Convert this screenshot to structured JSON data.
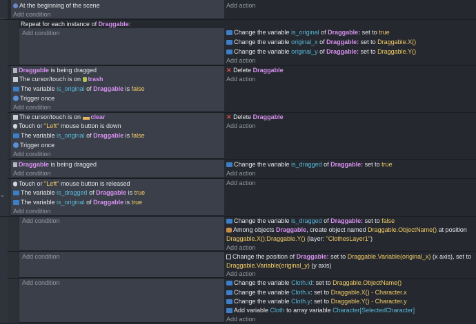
{
  "ui": {
    "add_condition": "Add condition",
    "add_action": "Add action"
  },
  "ev1": {
    "cond": "At the beginning of the scene"
  },
  "ev2": {
    "header_pre": "Repeat for each instance of ",
    "obj": "Draggable",
    "colon": ":",
    "a1": {
      "pre": "Change the variable ",
      "var": "is_original",
      "of": " of ",
      "obj": "Draggable:",
      "mid": " set to ",
      "val": "true"
    },
    "a2": {
      "pre": "Change the variable ",
      "var": "original_x",
      "of": " of ",
      "obj": "Draggable:",
      "mid": " set to ",
      "val": "Draggable.X()"
    },
    "a3": {
      "pre": "Change the variable ",
      "var": "original_y",
      "of": " of ",
      "obj": "Draggable:",
      "mid": " set to ",
      "val": "Draggable.Y()"
    }
  },
  "ev3": {
    "c1": {
      "obj": "Draggable",
      "txt": " is being dragged"
    },
    "c2": {
      "txt": "The cursor/touch is on ",
      "obj": "trash"
    },
    "c3": {
      "pre": "The variable ",
      "var": "is_original",
      "of": " of ",
      "obj": "Draggable",
      "is": " is ",
      "val": "false"
    },
    "c4": "Trigger once",
    "a1": {
      "pre": "Delete ",
      "obj": "Draggable"
    }
  },
  "ev4": {
    "c1": {
      "txt": "The cursor/touch is on ",
      "obj": "clear"
    },
    "c2": {
      "pre": "Touch or ",
      "val": "\"Left\"",
      "post": " mouse button is down"
    },
    "c3": {
      "pre": "The variable ",
      "var": "is_original",
      "of": " of ",
      "obj": "Draggable",
      "is": " is ",
      "val": "false"
    },
    "c4": "Trigger once",
    "a1": {
      "pre": "Delete ",
      "obj": "Draggable"
    }
  },
  "ev5": {
    "c1": {
      "obj": "Draggable",
      "txt": " is being dragged"
    },
    "a1": {
      "pre": "Change the variable ",
      "var": "is_dragged",
      "of": " of ",
      "obj": "Draggable:",
      "mid": " set to ",
      "val": "true"
    }
  },
  "ev6": {
    "c1": {
      "pre": "Touch or ",
      "val": "\"Left\"",
      "post": " mouse button is released"
    },
    "c2": {
      "pre": "The variable ",
      "var": "is_dragged",
      "of": " of ",
      "obj": "Draggable",
      "is": " is ",
      "val": "true"
    },
    "c3": {
      "pre": "The variable ",
      "var": "is_original",
      "of": " of ",
      "obj": "Draggable",
      "is": " is ",
      "val": "true"
    }
  },
  "ev7": {
    "a1": {
      "pre": "Change the variable ",
      "var": "is_dragged",
      "of": " of ",
      "obj": "Draggable:",
      "mid": " set to ",
      "val": "false"
    },
    "a2": {
      "pre": "Among objects ",
      "obj": "Draggable",
      "mid": ", create object named ",
      "val": "Draggable.ObjectName()",
      "post": " at position"
    },
    "a2b": {
      "val": "Draggable.X();Draggable.Y()",
      "post": " (layer: ",
      "val2": "\"ClothesLayer1\"",
      "end": ")"
    }
  },
  "ev8": {
    "a1": {
      "pre": "Change the position of ",
      "obj": "Draggable:",
      "mid": " set to ",
      "val": "Draggable.Variable(original_x)",
      "post": " (x axis), ",
      "set": "set to"
    },
    "a1b": {
      "val": "Draggable.Variable(original_y)",
      "post": " (y axis)"
    }
  },
  "ev9": {
    "a1": {
      "pre": "Change the variable ",
      "var": "Cloth.id",
      "mid": ": set to ",
      "val": "Draggable.ObjectName()"
    },
    "a2": {
      "pre": "Change the variable ",
      "var": "Cloth.x",
      "mid": ": set to ",
      "val": "Draggable.X() - Character.x"
    },
    "a3": {
      "pre": "Change the variable ",
      "var": "Cloth.y",
      "mid": ": set to ",
      "val": "Draggable.Y() - Character.y"
    },
    "a4": {
      "pre": "Add variable ",
      "var": "Cloth",
      "mid": " to array variable ",
      "val": "Character[SelectedCharacter]"
    }
  },
  "colors": {
    "object": "#d690ef",
    "variable": "#57b8d8",
    "value": "#f2cc68",
    "panel": "#3b3f49",
    "background": "#25282e"
  }
}
